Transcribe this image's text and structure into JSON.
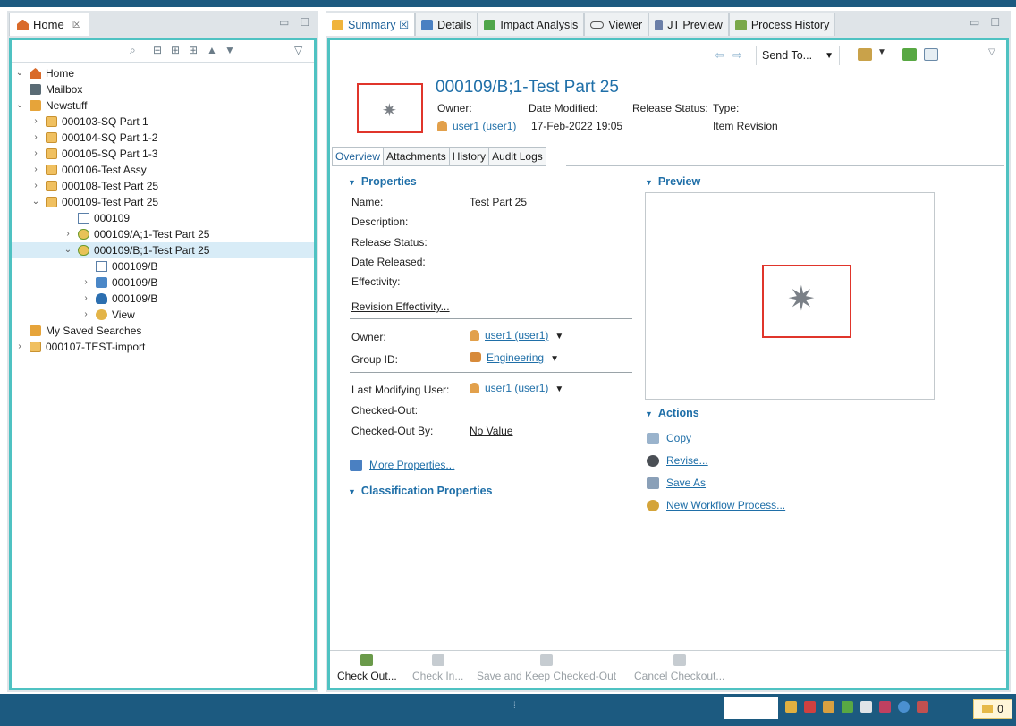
{
  "left_view": {
    "tab_label": "Home",
    "tab_close": "☒",
    "tree": [
      {
        "label": "Home",
        "icon": "home-icon",
        "twisty": "⌄"
      },
      {
        "label": "Mailbox",
        "icon": "mailbox-icon",
        "twisty": ""
      },
      {
        "label": "Newstuff",
        "icon": "folder-icon",
        "twisty": "⌄"
      },
      {
        "label": "000103-SQ Part 1",
        "icon": "item-icon",
        "twisty": "›"
      },
      {
        "label": "000104-SQ Part 1-2",
        "icon": "item-icon",
        "twisty": "›"
      },
      {
        "label": "000105-SQ Part 1-3",
        "icon": "item-icon",
        "twisty": "›"
      },
      {
        "label": "000106-Test Assy",
        "icon": "item-icon",
        "twisty": "›"
      },
      {
        "label": "000108-Test Part 25",
        "icon": "item-icon",
        "twisty": "›"
      },
      {
        "label": "000109-Test Part 25",
        "icon": "item-icon",
        "twisty": "⌄"
      },
      {
        "label": "000109",
        "icon": "form-icon",
        "twisty": ""
      },
      {
        "label": "000109/A;1-Test Part 25",
        "icon": "revision-icon",
        "twisty": "›"
      },
      {
        "label": "000109/B;1-Test Part 25",
        "icon": "revision-icon",
        "twisty": "⌄"
      },
      {
        "label": "000109/B",
        "icon": "form-icon",
        "twisty": ""
      },
      {
        "label": "000109/B",
        "icon": "dataset-icon",
        "twisty": "›"
      },
      {
        "label": "000109/B",
        "icon": "bom-icon",
        "twisty": "›"
      },
      {
        "label": "View",
        "icon": "view-icon",
        "twisty": "›"
      },
      {
        "label": "My Saved Searches",
        "icon": "folder-icon",
        "twisty": ""
      },
      {
        "label": "000107-TEST-import",
        "icon": "item-icon",
        "twisty": "›"
      }
    ]
  },
  "editor": {
    "tabs": [
      {
        "label": "Summary ☒",
        "icon": "summary-icon"
      },
      {
        "label": "Details",
        "icon": "details-icon"
      },
      {
        "label": "Impact Analysis",
        "icon": "impact-analysis-icon"
      },
      {
        "label": "Viewer",
        "icon": "viewer-icon"
      },
      {
        "label": "JT Preview",
        "icon": "jt-preview-icon"
      },
      {
        "label": "Process History",
        "icon": "process-history-icon"
      }
    ],
    "toolbar": {
      "send_to": "Send To..."
    },
    "header": {
      "title": "000109/B;1-Test Part 25",
      "owner_label": "Owner:",
      "owner_value": "user1 (user1)",
      "date_modified_label": "Date Modified:",
      "date_modified_value": "17-Feb-2022 19:05",
      "release_status_label": "Release Status:",
      "type_label": "Type:",
      "type_value": "Item Revision"
    },
    "subtabs": [
      "Overview",
      "Attachments",
      "History",
      "Audit Logs"
    ],
    "properties": {
      "heading": "Properties",
      "name_label": "Name:",
      "name_value": "Test Part 25",
      "description_label": "Description:",
      "release_status_label": "Release Status:",
      "date_released_label": "Date Released:",
      "effectivity_label": "Effectivity:",
      "revision_effectivity_link": "Revision Effectivity...",
      "owner_label": "Owner:",
      "owner_value": "user1 (user1)",
      "group_label": "Group ID:",
      "group_value": "Engineering",
      "last_mod_label": "Last Modifying User:",
      "last_mod_value": "user1 (user1)",
      "checked_out_label": "Checked-Out:",
      "checked_out_by_label": "Checked-Out By:",
      "checked_out_by_value": "No Value",
      "more_properties": "More Properties...",
      "classification_heading": "Classification Properties"
    },
    "preview": {
      "heading": "Preview"
    },
    "actions": {
      "heading": "Actions",
      "items": [
        {
          "label": "Copy",
          "icon": "copy-icon"
        },
        {
          "label": "Revise...",
          "icon": "revise-icon"
        },
        {
          "label": "Save As",
          "icon": "save-as-icon"
        },
        {
          "label": "New Workflow Process...",
          "icon": "workflow-icon"
        }
      ]
    },
    "footer": [
      {
        "label": "Check Out...",
        "enabled": true
      },
      {
        "label": "Check In...",
        "enabled": false
      },
      {
        "label": "Save and Keep Checked-Out",
        "enabled": false
      },
      {
        "label": "Cancel Checkout...",
        "enabled": false
      }
    ]
  },
  "status_bar": {
    "dots": "⁞",
    "notification_count": "0"
  },
  "colors": {
    "accent_frame": "#4fc2c2",
    "chrome_blue": "#1c5a80",
    "link_blue": "#1f6fa8",
    "highlight_red": "#e0352b"
  }
}
